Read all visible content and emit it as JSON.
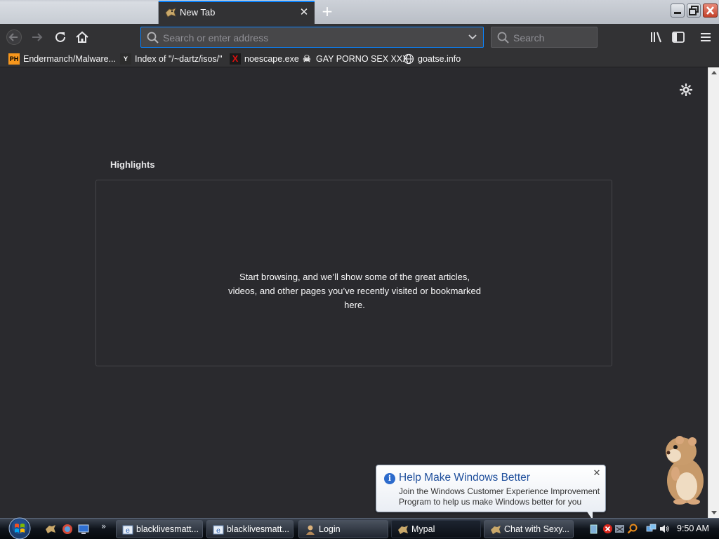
{
  "browser": {
    "tab": {
      "title": "New Tab"
    },
    "urlbar": {
      "placeholder": "Search or enter address"
    },
    "searchbar": {
      "placeholder": "Search"
    }
  },
  "bookmarks": [
    {
      "label": "Endermanch/Malware...",
      "icon": "pornhub-icon",
      "icon_text": "PH"
    },
    {
      "label": "Index of \"/~dartz/isos/\"",
      "icon": "ycombinator-icon",
      "icon_text": "Y"
    },
    {
      "label": "noescape.exe",
      "icon": "red-x-icon",
      "icon_text": "X"
    },
    {
      "label": "GAY PORNO SEX XXX",
      "icon": "skull-icon",
      "icon_text": "☠"
    },
    {
      "label": "goatse.info",
      "icon": "globe-icon",
      "icon_text": ""
    }
  ],
  "page": {
    "section_title": "Highlights",
    "empty_message": "Start browsing, and we’ll show some of the great articles, videos, and other pages you’ve recently visited or bookmarked here."
  },
  "balloon": {
    "title": "Help Make Windows Better",
    "body": "Join the Windows Customer Experience Improvement Program to help us make Windows better for you"
  },
  "taskbar": {
    "items": [
      {
        "label": "blacklivesmatt...",
        "icon": "ie-icon"
      },
      {
        "label": "blacklivesmatt...",
        "icon": "ie-icon"
      },
      {
        "label": "Login",
        "icon": "user-icon"
      },
      {
        "label": "Mypal",
        "icon": "mypal-icon",
        "active": true
      },
      {
        "label": "Chat with Sexy...",
        "icon": "mypal-icon"
      }
    ],
    "clock": "9:50 AM"
  },
  "colors": {
    "accent": "#0a84ff",
    "content_bg": "#2a2a2e",
    "toolbar_bg": "#323234",
    "balloon_title": "#1f4f9c"
  }
}
